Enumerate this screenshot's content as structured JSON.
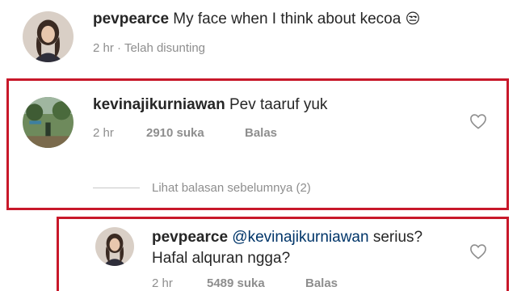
{
  "comments": [
    {
      "username": "pevpearce",
      "text": "My face when I think about kecoa",
      "emoji": "😒",
      "time": "2 hr",
      "separator": "·",
      "edited": "Telah disunting"
    },
    {
      "username": "kevinajikurniawan",
      "text": "Pev taaruf yuk",
      "time": "2 hr",
      "likes": "2910 suka",
      "reply": "Balas",
      "view_replies": "Lihat balasan sebelumnya (2)"
    },
    {
      "username": "pevpearce",
      "mention": "@kevinajikurniawan",
      "text_line1": "serius?",
      "text_line2": "Hafal alquran ngga?",
      "time": "2 hr",
      "likes": "5489 suka",
      "reply": "Balas"
    }
  ],
  "colors": {
    "highlight": "#c8182a",
    "mention": "#003569",
    "meta": "#8e8e8e"
  },
  "icons": {
    "like": "heart-outline-icon"
  }
}
